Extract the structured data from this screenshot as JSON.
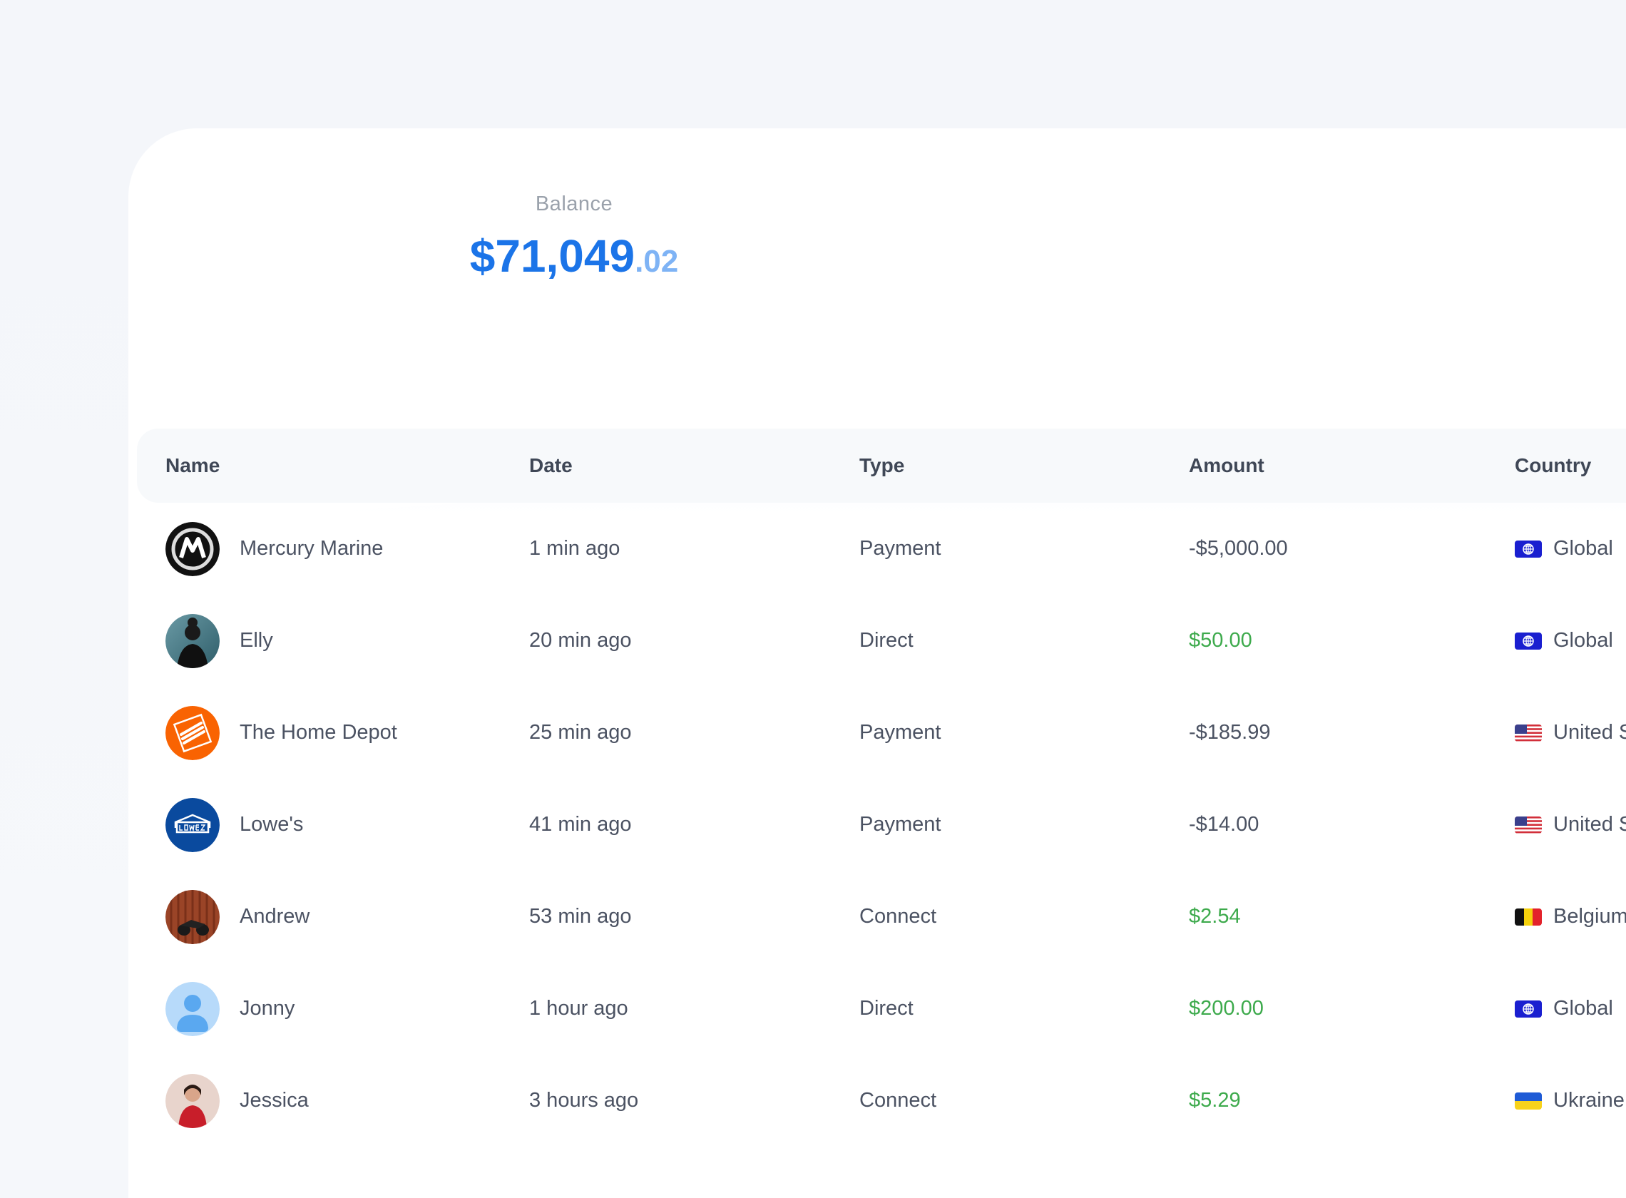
{
  "balance": {
    "label": "Balance",
    "dollars": "$71,049",
    "cents": ".02"
  },
  "colors": {
    "accent": "#1b74e8",
    "positive": "#3daa4c",
    "text": "#4b5262"
  },
  "table": {
    "headers": {
      "name": "Name",
      "date": "Date",
      "type": "Type",
      "amount": "Amount",
      "country": "Country"
    },
    "rows": [
      {
        "name": "Mercury Marine",
        "date": "1 min ago",
        "type": "Payment",
        "amount": "-$5,000.00",
        "positive": false,
        "country": "Global",
        "flag": "globe-icon",
        "avatar": "mercury-logo"
      },
      {
        "name": "Elly",
        "date": "20 min ago",
        "type": "Direct",
        "amount": "$50.00",
        "positive": true,
        "country": "Global",
        "flag": "globe-icon",
        "avatar": "person-photo"
      },
      {
        "name": "The Home Depot",
        "date": "25 min ago",
        "type": "Payment",
        "amount": "-$185.99",
        "positive": false,
        "country": "United S",
        "flag": "us-flag-icon",
        "avatar": "home-depot-logo"
      },
      {
        "name": "Lowe's",
        "date": "41 min ago",
        "type": "Payment",
        "amount": "-$14.00",
        "positive": false,
        "country": "United S",
        "flag": "us-flag-icon",
        "avatar": "lowes-logo"
      },
      {
        "name": "Andrew",
        "date": "53 min ago",
        "type": "Connect",
        "amount": "$2.54",
        "positive": true,
        "country": "Belgium",
        "flag": "belgium-flag-icon",
        "avatar": "person-photo"
      },
      {
        "name": "Jonny",
        "date": "1 hour ago",
        "type": "Direct",
        "amount": "$200.00",
        "positive": true,
        "country": "Global",
        "flag": "globe-icon",
        "avatar": "default-user-icon"
      },
      {
        "name": "Jessica",
        "date": "3 hours ago",
        "type": "Connect",
        "amount": "$5.29",
        "positive": true,
        "country": "Ukraine",
        "flag": "ukraine-flag-icon",
        "avatar": "person-photo"
      }
    ]
  }
}
